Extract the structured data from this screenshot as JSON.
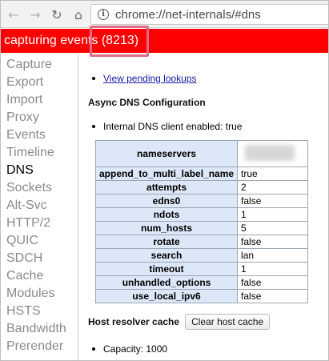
{
  "browser": {
    "back_glyph": "←",
    "forward_glyph": "→",
    "reload_glyph": "↻",
    "home_glyph": "⌂",
    "info_glyph": "i",
    "url": "chrome://net-internals/#dns"
  },
  "status": {
    "text": "capturing events (8213)",
    "color": "#ff0000",
    "highlight_color": "#e06b8a"
  },
  "sidebar": {
    "items": [
      {
        "label": "Capture",
        "active": false
      },
      {
        "label": "Export",
        "active": false
      },
      {
        "label": "Import",
        "active": false
      },
      {
        "label": "Proxy",
        "active": false
      },
      {
        "label": "Events",
        "active": false
      },
      {
        "label": "Timeline",
        "active": false
      },
      {
        "label": "DNS",
        "active": true
      },
      {
        "label": "Sockets",
        "active": false
      },
      {
        "label": "Alt-Svc",
        "active": false
      },
      {
        "label": "HTTP/2",
        "active": false
      },
      {
        "label": "QUIC",
        "active": false
      },
      {
        "label": "SDCH",
        "active": false
      },
      {
        "label": "Cache",
        "active": false
      },
      {
        "label": "Modules",
        "active": false
      },
      {
        "label": "HSTS",
        "active": false
      },
      {
        "label": "Bandwidth",
        "active": false
      },
      {
        "label": "Prerender",
        "active": false
      }
    ]
  },
  "main": {
    "pending_link": "View pending lookups",
    "async_title": "Async DNS Configuration",
    "internal_client": "Internal DNS client enabled: true",
    "config_rows": [
      {
        "key": "nameservers",
        "value": "",
        "redacted": true
      },
      {
        "key": "append_to_multi_label_name",
        "value": "true"
      },
      {
        "key": "attempts",
        "value": "2"
      },
      {
        "key": "edns0",
        "value": "false"
      },
      {
        "key": "ndots",
        "value": "1"
      },
      {
        "key": "num_hosts",
        "value": "5"
      },
      {
        "key": "rotate",
        "value": "false"
      },
      {
        "key": "search",
        "value": "lan"
      },
      {
        "key": "timeout",
        "value": "1"
      },
      {
        "key": "unhandled_options",
        "value": "false"
      },
      {
        "key": "use_local_ipv6",
        "value": "false"
      }
    ],
    "cache_title": "Host resolver cache",
    "clear_button": "Clear host cache",
    "capacity": "Capacity: 1000"
  },
  "colors": {
    "table_key_bg": "#dce8f7",
    "link": "#1a1aa6"
  }
}
